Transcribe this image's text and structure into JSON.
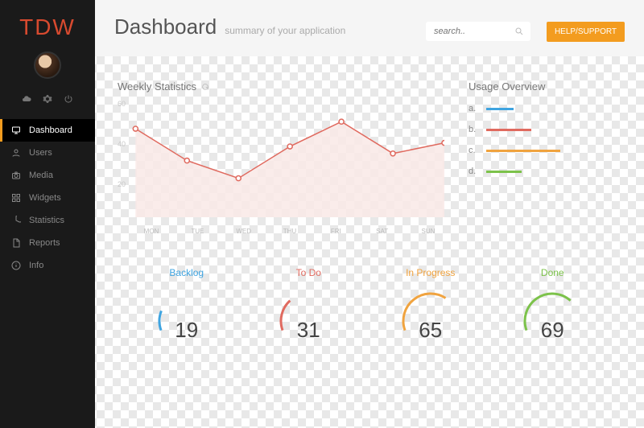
{
  "logo": "TDW",
  "header": {
    "title": "Dashboard",
    "subtitle": "summary of your application"
  },
  "search": {
    "placeholder": "search.."
  },
  "help_label": "HELP/SUPPORT",
  "nav": [
    {
      "label": "Dashboard",
      "icon": "monitor",
      "active": true
    },
    {
      "label": "Users",
      "icon": "user"
    },
    {
      "label": "Media",
      "icon": "camera"
    },
    {
      "label": "Widgets",
      "icon": "grid"
    },
    {
      "label": "Statistics",
      "icon": "pie"
    },
    {
      "label": "Reports",
      "icon": "file"
    },
    {
      "label": "Info",
      "icon": "info"
    }
  ],
  "weekly": {
    "title": "Weekly Statistics"
  },
  "usage": {
    "title": "Usage Overview",
    "rows": [
      {
        "label": "a.",
        "width": 34,
        "color": "#3fa4e0"
      },
      {
        "label": "b.",
        "width": 56,
        "color": "#e06a5f"
      },
      {
        "label": "c.",
        "width": 92,
        "color": "#f0a33f"
      },
      {
        "label": "d.",
        "width": 44,
        "color": "#7cc24a"
      }
    ]
  },
  "gauges": [
    {
      "title": "Backlog",
      "value": "19",
      "color": "#3fa4e0",
      "pct": 19
    },
    {
      "title": "To Do",
      "value": "31",
      "color": "#e06a5f",
      "pct": 31
    },
    {
      "title": "In Progress",
      "value": "65",
      "color": "#f0a33f",
      "pct": 65
    },
    {
      "title": "Done",
      "value": "69",
      "color": "#7cc24a",
      "pct": 69
    }
  ],
  "chart_data": {
    "type": "line",
    "title": "Weekly Statistics",
    "ylabel": "",
    "xlabel": "",
    "ylim": [
      0,
      60
    ],
    "yticks": [
      20,
      40,
      60
    ],
    "categories": [
      "MON",
      "TUE",
      "WED",
      "THU",
      "FRI",
      "SAT",
      "SUN"
    ],
    "values": [
      50,
      32,
      22,
      40,
      54,
      36,
      42
    ]
  }
}
